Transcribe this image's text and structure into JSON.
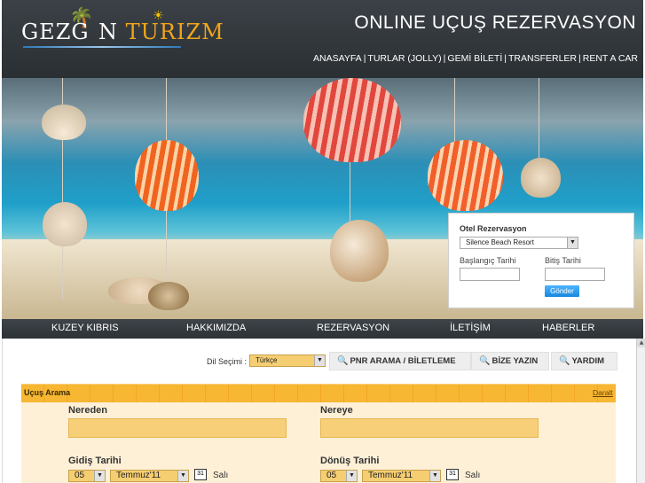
{
  "header": {
    "logo_part1": "GEZG",
    "logo_part2": "N",
    "logo_part3": "TURIZM",
    "site_title": "ONLINE UÇUŞ REZERVASYON",
    "top_nav": [
      "ANASAYFA",
      "TURLAR (JOLLY)",
      "GEMİ BİLETİ",
      "TRANSFERLER",
      "RENT A CAR"
    ]
  },
  "otel": {
    "title": "Otel Rezervasyon",
    "selected_hotel": "Silence Beach Resort",
    "start_label": "Başlangıç Tarihi",
    "end_label": "Bitiş Tarihi",
    "submit_label": "Gönder"
  },
  "main_nav": [
    "KUZEY KIBRIS",
    "HAKKIMIZDA",
    "REZERVASYON",
    "İLETİŞİM",
    "HABERLER"
  ],
  "toolbar": {
    "language_label": "Dil Seçimi :",
    "language_value": "Türkçe",
    "pnr_button": "PNR ARAMA / BİLETLEME",
    "contact_button": "BİZE YAZIN",
    "help_button": "YARDIM"
  },
  "flight": {
    "section_title": "Uçuş Arama",
    "collapse_label": "Daralt",
    "from_label": "Nereden",
    "to_label": "Nereye",
    "depart_label": "Gidiş Tarihi",
    "return_label": "Dönüş Tarihi",
    "depart_day": "05",
    "depart_month": "Temmuz'11",
    "depart_weekday": "Salı",
    "return_day": "05",
    "return_month": "Temmuz'11",
    "return_weekday": "Salı",
    "calendar_icon_text": "31"
  },
  "colors": {
    "header_bg": "#2f3438",
    "accent_orange": "#f7b733",
    "form_bg": "#fdf0d6",
    "button_blue": "#1588e0"
  }
}
